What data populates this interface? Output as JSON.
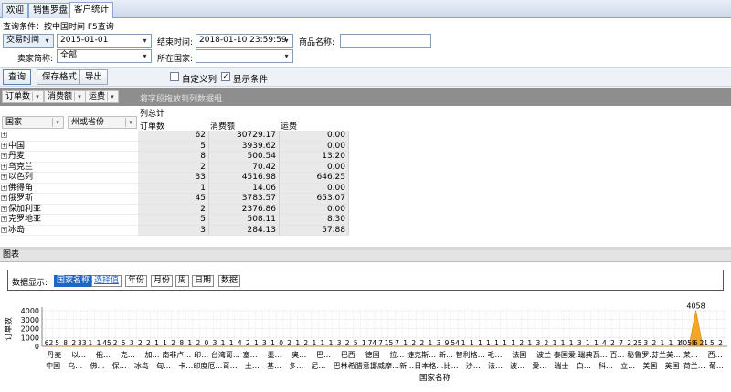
{
  "tabs": [
    {
      "label": "欢迎"
    },
    {
      "label": "销售罗盘"
    },
    {
      "label": "客户统计"
    }
  ],
  "query": {
    "conditions_text": "查询条件：按中国时间   F5查询",
    "time_type": "交易时间",
    "start_date": "2015-01-01",
    "end_label": "结束时间:",
    "end_value": "2018-01-10 23:59:59",
    "product_label": "商品名称:",
    "product_value": "",
    "seller_label": "卖家简称:",
    "seller_value": "全部",
    "country_label": "所在国家:",
    "country_value": ""
  },
  "toolbar": {
    "query": "查询",
    "save_format": "保存格式",
    "export": "导出",
    "custom_columns": "自定义列",
    "custom_columns_checked": false,
    "show_conditions": "显示条件",
    "show_conditions_checked": true
  },
  "pivot": {
    "data_fields": [
      "订单数",
      "消费额",
      "运费"
    ],
    "drop_hint": "将字段拖放到列数据组",
    "row_fields": [
      "国家",
      "州或省份"
    ],
    "col_total": "列总计",
    "col_headers": [
      "订单数",
      "消费额",
      "运费"
    ],
    "rows": [
      {
        "name": "",
        "orders": "62",
        "amount": "30729.17",
        "freight": "0.00"
      },
      {
        "name": "中国",
        "orders": "5",
        "amount": "3939.62",
        "freight": "0.00"
      },
      {
        "name": "丹麦",
        "orders": "8",
        "amount": "500.54",
        "freight": "13.20"
      },
      {
        "name": "乌克兰",
        "orders": "2",
        "amount": "70.42",
        "freight": "0.00"
      },
      {
        "name": "以色列",
        "orders": "33",
        "amount": "4516.98",
        "freight": "646.25"
      },
      {
        "name": "佛得角",
        "orders": "1",
        "amount": "14.06",
        "freight": "0.00"
      },
      {
        "name": "俄罗斯",
        "orders": "45",
        "amount": "3783.57",
        "freight": "653.07"
      },
      {
        "name": "保加利亚",
        "orders": "2",
        "amount": "2376.86",
        "freight": "0.00"
      },
      {
        "name": "克罗地亚",
        "orders": "5",
        "amount": "508.11",
        "freight": "8.30"
      },
      {
        "name": "冰岛",
        "orders": "3",
        "amount": "284.13",
        "freight": "57.88"
      }
    ]
  },
  "chart_panel": {
    "title": "图表",
    "display_label": "数据显示:",
    "options": [
      "国家名称",
      "选择值",
      "年份",
      "月份",
      "周",
      "日期",
      "数据"
    ],
    "selected": "国家名称"
  },
  "chart_data": {
    "type": "area",
    "ylabel": "订单数",
    "xlabel": "国家名称",
    "ylim": [
      0,
      4000
    ],
    "yticks": [
      "4000",
      "3000",
      "2000",
      "1000",
      "0"
    ],
    "values": [
      62,
      5,
      8,
      2,
      33,
      1,
      45,
      2,
      5,
      3,
      2,
      2,
      1,
      1,
      2,
      1,
      1,
      2,
      6,
      3,
      2,
      1,
      1,
      2,
      2,
      1,
      0,
      1,
      2,
      1,
      4,
      1,
      2,
      1,
      3,
      1,
      1,
      1,
      2,
      1,
      1,
      1,
      1,
      1,
      2,
      2,
      1,
      1,
      1,
      2,
      1,
      1,
      1,
      4,
      7,
      1,
      5,
      1,
      1,
      1,
      2,
      2,
      3,
      9,
      54,
      1,
      1,
      1,
      1,
      1,
      1,
      1,
      2,
      1,
      1,
      3,
      2,
      2,
      1,
      7,
      2,
      25,
      1,
      3,
      1,
      1,
      1,
      1,
      1,
      1,
      2,
      1,
      1,
      4058,
      6,
      21,
      5,
      2
    ],
    "value_labels": [
      "62",
      "5",
      "8",
      "2",
      "33",
      "1",
      "1",
      "45",
      "2",
      "5",
      "3",
      "2",
      "2",
      "1",
      "1",
      "2",
      "8",
      "1",
      "2",
      "0",
      "3",
      "1",
      "1",
      "4",
      "2",
      "1",
      "3",
      "1",
      "0",
      "2",
      "1",
      "2",
      "1",
      "1",
      "1",
      "3",
      "2",
      "5",
      "1",
      "74",
      "7",
      "15",
      "7",
      "1",
      "2",
      "2",
      "1",
      "3",
      "9",
      "54",
      "1",
      "1",
      "1",
      "1",
      "1",
      "1",
      "1",
      "2",
      "1",
      "3",
      "2",
      "1",
      "1",
      "1",
      "3",
      "1",
      "1",
      "4",
      "2",
      "7",
      "2",
      "25",
      "3",
      "2",
      "1",
      "1",
      "1",
      "4058",
      "6",
      "21",
      "5",
      "2"
    ],
    "peak_label": "4058",
    "xtick_row1": [
      "丹麦",
      "以…",
      "俄…",
      "克…",
      "加…",
      "南非卢…",
      "印…",
      "台湾哥…",
      "塞…",
      "墨…",
      "奥…",
      "巴…",
      "巴西",
      "德国",
      "拉…",
      "捷克斯…",
      "新…",
      "智利格…",
      "毛…",
      "法国",
      "波兰",
      "泰国爱…",
      "瑞典瓦…",
      "百…",
      "秘鲁罗…",
      "芬兰英…",
      "莱…",
      "西…"
    ],
    "xtick_row2": [
      "中国",
      "乌…",
      "佛…",
      "保…",
      "冰岛",
      "匈…",
      "卡…",
      "印度厄…",
      "哥…",
      "土…",
      "基…",
      "多…",
      "尼…",
      "巴林",
      "希腊意…",
      "挪威摩…",
      "新…",
      "日本格…",
      "比…",
      "沙…",
      "法…",
      "波…",
      "爱…",
      "瑞士",
      "白…",
      "科…",
      "立…",
      "美国",
      "英国",
      "荷兰…",
      "葡…"
    ]
  }
}
